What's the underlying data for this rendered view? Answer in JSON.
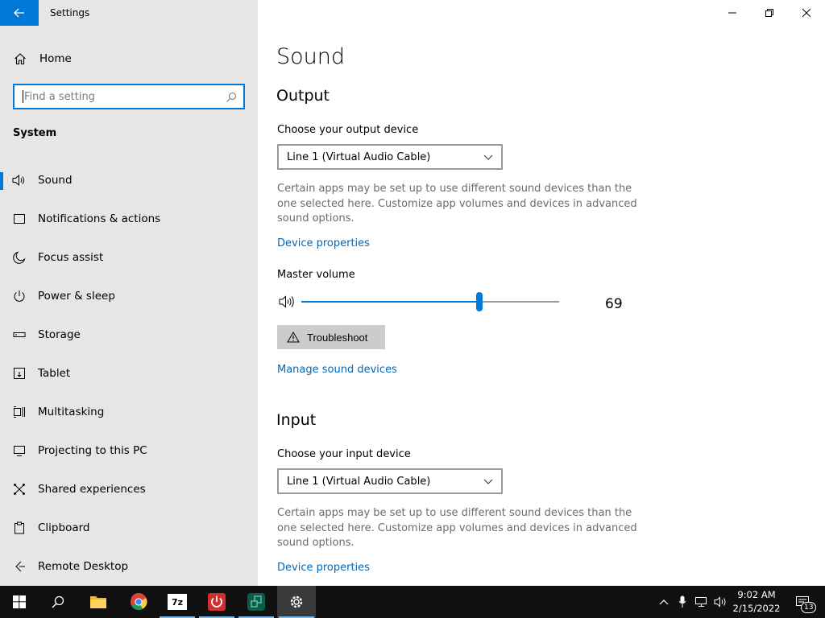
{
  "window": {
    "title": "Settings",
    "minimize_glyph": "—",
    "close_glyph": "✕"
  },
  "sidebar": {
    "home_label": "Home",
    "search_placeholder": "Find a setting",
    "section_label": "System",
    "items": [
      {
        "label": "Sound",
        "icon": "speaker-icon",
        "active": true
      },
      {
        "label": "Notifications & actions",
        "icon": "notification-icon"
      },
      {
        "label": "Focus assist",
        "icon": "moon-icon"
      },
      {
        "label": "Power & sleep",
        "icon": "power-icon"
      },
      {
        "label": "Storage",
        "icon": "storage-icon"
      },
      {
        "label": "Tablet",
        "icon": "tablet-icon"
      },
      {
        "label": "Multitasking",
        "icon": "multitasking-icon"
      },
      {
        "label": "Projecting to this PC",
        "icon": "projecting-icon"
      },
      {
        "label": "Shared experiences",
        "icon": "shared-experiences-icon"
      },
      {
        "label": "Clipboard",
        "icon": "clipboard-icon"
      },
      {
        "label": "Remote Desktop",
        "icon": "remote-desktop-icon"
      }
    ]
  },
  "main": {
    "title": "Sound",
    "output": {
      "heading": "Output",
      "device_label": "Choose your output device",
      "device_value": "Line 1 (Virtual Audio Cable)",
      "description": "Certain apps may be set up to use different sound devices than the one selected here. Customize app volumes and devices in advanced sound options.",
      "properties_link": "Device properties",
      "volume_label": "Master volume",
      "volume_value": "69",
      "troubleshoot_label": "Troubleshoot",
      "manage_link": "Manage sound devices"
    },
    "input": {
      "heading": "Input",
      "device_label": "Choose your input device",
      "device_value": "Line 1 (Virtual Audio Cable)",
      "description": "Certain apps may be set up to use different sound devices than the one selected here. Customize app volumes and devices in advanced sound options.",
      "properties_link": "Device properties"
    }
  },
  "taskbar": {
    "apps": [
      "start-icon",
      "search-icon",
      "file-explorer-icon",
      "chrome-icon",
      "7zip-icon",
      "power-app-icon",
      "remote-app-icon",
      "settings-icon"
    ],
    "sevenzip_label": "7z",
    "time": "9:02 AM",
    "date": "2/15/2022",
    "notification_count": "13"
  },
  "colors": {
    "accent": "#0078d7",
    "link": "#0067b8",
    "sidebar_bg": "#e6e6e6",
    "taskbar_bg": "#101010"
  }
}
